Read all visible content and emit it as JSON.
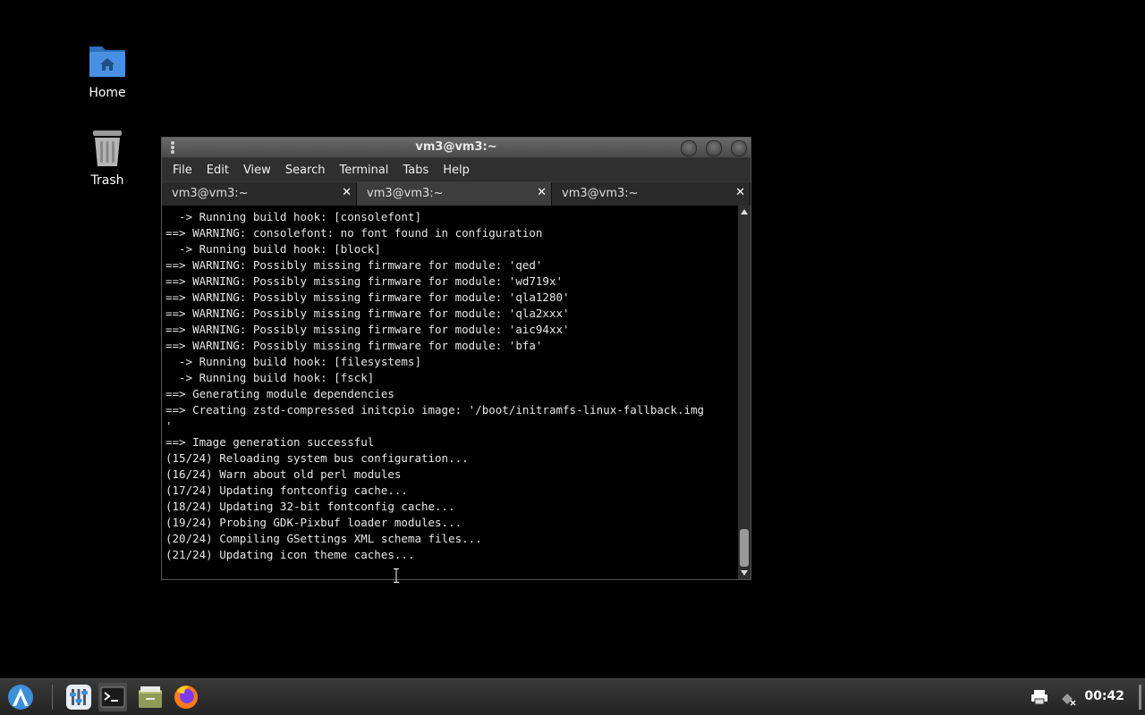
{
  "desktop": {
    "icons": [
      {
        "label": "Home"
      },
      {
        "label": "Trash"
      }
    ]
  },
  "window": {
    "title": "vm3@vm3:~",
    "menu": [
      "File",
      "Edit",
      "View",
      "Search",
      "Terminal",
      "Tabs",
      "Help"
    ],
    "tabs": [
      {
        "label": "vm3@vm3:~",
        "active": false
      },
      {
        "label": "vm3@vm3:~",
        "active": true
      },
      {
        "label": "vm3@vm3:~",
        "active": false
      }
    ],
    "tab_close_glyph": "✕",
    "terminal_lines": [
      "  -> Running build hook: [consolefont]",
      "==> WARNING: consolefont: no font found in configuration",
      "  -> Running build hook: [block]",
      "==> WARNING: Possibly missing firmware for module: 'qed'",
      "==> WARNING: Possibly missing firmware for module: 'wd719x'",
      "==> WARNING: Possibly missing firmware for module: 'qla1280'",
      "==> WARNING: Possibly missing firmware for module: 'qla2xxx'",
      "==> WARNING: Possibly missing firmware for module: 'aic94xx'",
      "==> WARNING: Possibly missing firmware for module: 'bfa'",
      "  -> Running build hook: [filesystems]",
      "  -> Running build hook: [fsck]",
      "==> Generating module dependencies",
      "==> Creating zstd-compressed initcpio image: '/boot/initramfs-linux-fallback.img",
      "'",
      "==> Image generation successful",
      "(15/24) Reloading system bus configuration...",
      "(16/24) Warn about old perl modules",
      "(17/24) Updating fontconfig cache...",
      "(18/24) Updating 32-bit fontconfig cache...",
      "(19/24) Probing GDK-Pixbuf loader modules...",
      "(20/24) Compiling GSettings XML schema files...",
      "(21/24) Updating icon theme caches..."
    ]
  },
  "taskbar": {
    "items": [
      "app-menu-icon",
      "settings-app-icon",
      "terminal-icon",
      "file-manager-icon",
      "firefox-icon"
    ],
    "tray": [
      "printer-icon",
      "network-disconnected-icon"
    ],
    "clock": "00:42"
  },
  "colors": {
    "desktop_bg": "#000000",
    "accent_blue": "#3d8fd8",
    "folder_blue": "#4a90e2"
  }
}
